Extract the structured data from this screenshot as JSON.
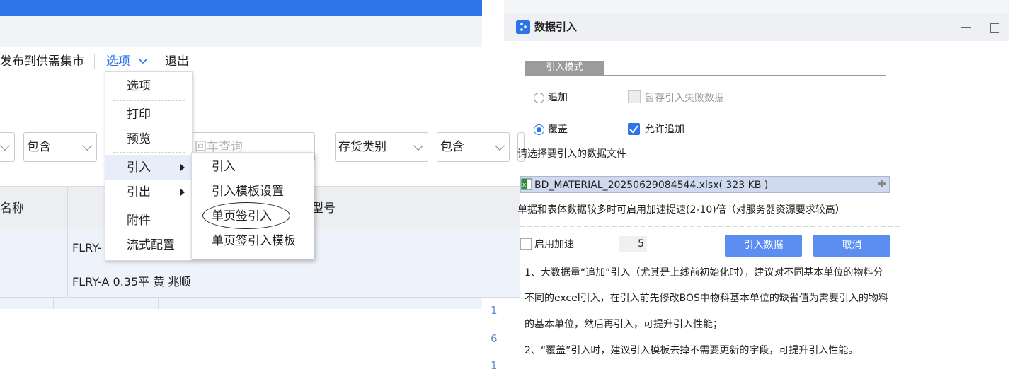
{
  "toolbar": {
    "publish_label": "发布到供需集市",
    "options_label": "选项",
    "exit_label": "退出"
  },
  "filters": {
    "op1": "包含",
    "search_placeholder": "回车查询",
    "field2": "存货类别",
    "op2": "包含"
  },
  "grid": {
    "col_name": "名称",
    "col_model_partial": "型号",
    "rows": [
      "FLRY-",
      "FLRY-A 0.35平 黄 兆顺"
    ],
    "row_numbers": [
      "1",
      "6",
      "1"
    ]
  },
  "options_menu": {
    "items": [
      "选项",
      "打印",
      "预览",
      "引入",
      "引出",
      "附件",
      "流式配置"
    ]
  },
  "import_submenu": {
    "items": [
      "引入",
      "引入模板设置",
      "单页签引入",
      "单页签引入模板"
    ]
  },
  "dialog": {
    "title": "数据引入",
    "mode_tab": "引入模式",
    "append_label": "追加",
    "cover_label": "覆盖",
    "save_failed_label": "暂存引入失败数据",
    "allow_append_label": "允许追加",
    "select_file_label": "请选择要引入的数据文件",
    "file_name": "BD_MATERIAL_20250629084544.xlsx( 323 KB )",
    "speedup_hint": "单据和表体数据较多时可启用加速提速(2-10)倍（对服务器资源要求较高）",
    "enable_speedup_label": "启用加速",
    "speed_value": "5",
    "import_button": "引入数据",
    "cancel_button": "取消",
    "notes": [
      "1、大数据量“追加”引入（尤其是上线前初始化时），建议对不同基本单位的物料分",
      "不同的excel引入，在引入前先修改BOS中物料基本单位的缺省值为需要引入的物料",
      "的基本单位，然后再引入，可提升引入性能；",
      "2、“覆盖”引入时，建议引入模板去掉不需要更新的字段，可提升引入性能。"
    ],
    "mode": "cover",
    "allow_append_checked": true
  },
  "colors": {
    "accent": "#2d74e8",
    "button": "#5b8ef0",
    "selected_file": "#cfd9ef"
  }
}
